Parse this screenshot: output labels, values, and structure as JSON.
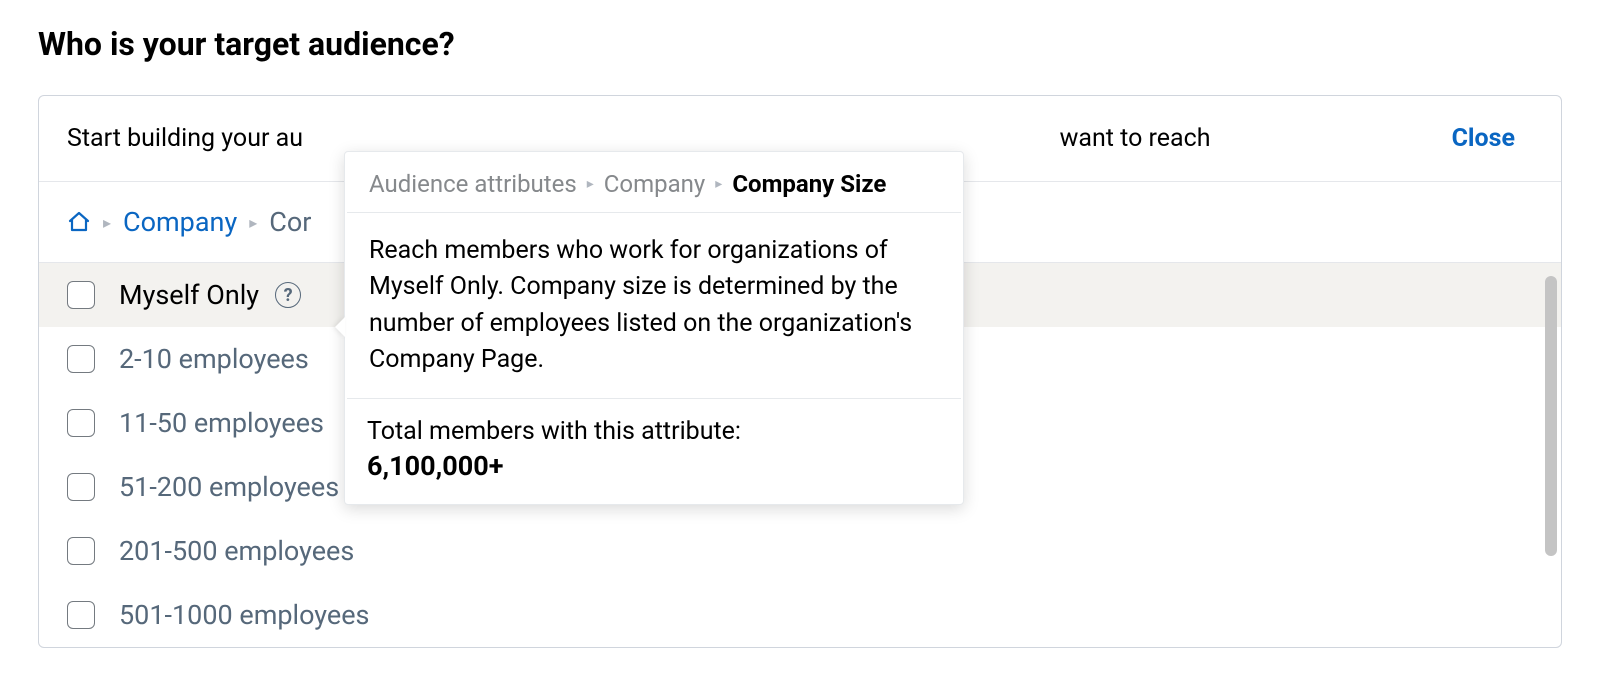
{
  "title": "Who is your target audience?",
  "panel": {
    "intro_text_left": "Start building your au",
    "intro_text_right": "want to reach",
    "close_label": "Close"
  },
  "breadcrumb": {
    "company": "Company",
    "truncated": "Cor"
  },
  "options": [
    {
      "label": "Myself Only",
      "highlighted": true,
      "help": true
    },
    {
      "label": "2-10 employees"
    },
    {
      "label": "11-50 employees"
    },
    {
      "label": "51-200 employees"
    },
    {
      "label": "201-500 employees"
    },
    {
      "label": "501-1000 employees"
    }
  ],
  "tooltip": {
    "crumb1": "Audience attributes",
    "crumb2": "Company",
    "crumb3": "Company Size",
    "description": "Reach members who work for organizations of Myself Only. Company size is determined by the number of employees listed on the organization's Company Page.",
    "footer_label": "Total members with this attribute:",
    "count": "6,100,000+"
  }
}
